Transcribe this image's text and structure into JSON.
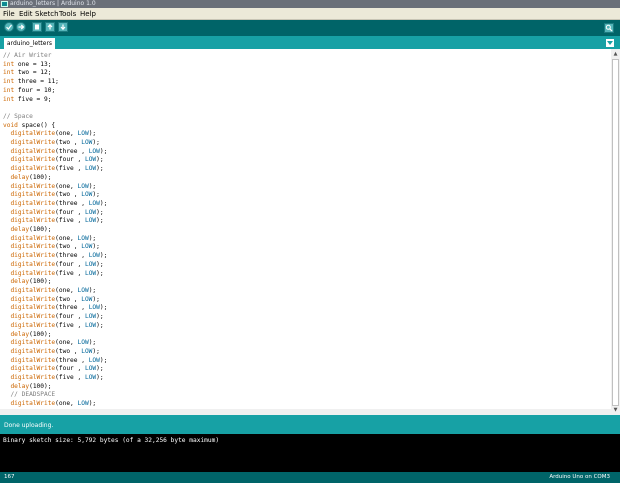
{
  "window": {
    "title": "arduino_letters | Arduino 1.0"
  },
  "menubar": {
    "items": [
      "File",
      "Edit",
      "Sketch",
      "Tools",
      "Help"
    ]
  },
  "toolbar": {
    "buttons": [
      "verify-icon",
      "upload-icon",
      "new-icon",
      "open-icon",
      "save-icon",
      "serial-monitor-icon"
    ]
  },
  "tabs": {
    "active": "arduino_letters"
  },
  "editor": {
    "lines": [
      "// Air Writer",
      "int one = 13;",
      "int two = 12;",
      "int three = 11;",
      "int four = 10;",
      "int five = 9;",
      "",
      "// Space",
      "void space() {",
      "  digitalWrite(one, LOW);",
      "  digitalWrite(two , LOW);",
      "  digitalWrite(three , LOW);",
      "  digitalWrite(four , LOW);",
      "  digitalWrite(five , LOW);",
      "  delay(100);",
      "  digitalWrite(one, LOW);",
      "  digitalWrite(two , LOW);",
      "  digitalWrite(three , LOW);",
      "  digitalWrite(four , LOW);",
      "  digitalWrite(five , LOW);",
      "  delay(100);",
      "  digitalWrite(one, LOW);",
      "  digitalWrite(two , LOW);",
      "  digitalWrite(three , LOW);",
      "  digitalWrite(four , LOW);",
      "  digitalWrite(five , LOW);",
      "  delay(100);",
      "  digitalWrite(one, LOW);",
      "  digitalWrite(two , LOW);",
      "  digitalWrite(three , LOW);",
      "  digitalWrite(four , LOW);",
      "  digitalWrite(five , LOW);",
      "  delay(100);",
      "  digitalWrite(one, LOW);",
      "  digitalWrite(two , LOW);",
      "  digitalWrite(three , LOW);",
      "  digitalWrite(four , LOW);",
      "  digitalWrite(five , LOW);",
      "  delay(100);",
      "  // DEADSPACE",
      "  digitalWrite(one, LOW);"
    ]
  },
  "status": {
    "message": "Done uploading."
  },
  "console": {
    "output": "Binary sketch size: 5,792 bytes (of a 32,256 byte maximum)"
  },
  "footer": {
    "line": "167",
    "board": "Arduino Uno on COM3"
  },
  "colors": {
    "frame": "#006468",
    "tab_strip": "#17a1a5",
    "keyword": "#cc6600",
    "constant": "#006699",
    "comment": "#7e7e7e"
  }
}
